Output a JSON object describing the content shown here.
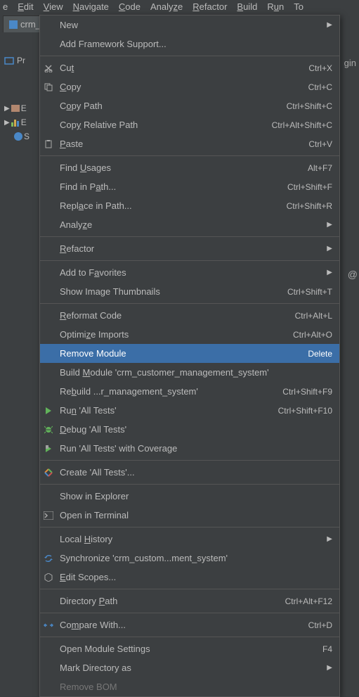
{
  "menubar": {
    "file": "e",
    "edit": "Edit",
    "view": "View",
    "navigate": "Navigate",
    "code": "Code",
    "analyze": "Analyze",
    "refactor": "Refactor",
    "build": "Build",
    "run": "Run",
    "tools": "To"
  },
  "tab": {
    "label": "crm_c"
  },
  "sidebar": {
    "project": "Pr",
    "tree1": "E",
    "tree2": "E",
    "tree3": "S"
  },
  "bg": {
    "gin": "gin",
    "at": "@"
  },
  "menu": {
    "new": "New",
    "addfw": "Add Framework Support...",
    "cut": "Cut",
    "cut_s": "Ctrl+X",
    "copy": "Copy",
    "copy_s": "Ctrl+C",
    "copypath": "Copy Path",
    "copypath_s": "Ctrl+Shift+C",
    "copyrel": "Copy Relative Path",
    "copyrel_s": "Ctrl+Alt+Shift+C",
    "paste": "Paste",
    "paste_s": "Ctrl+V",
    "findu": "Find Usages",
    "findu_s": "Alt+F7",
    "findp": "Find in Path...",
    "findp_s": "Ctrl+Shift+F",
    "replp": "Replace in Path...",
    "replp_s": "Ctrl+Shift+R",
    "analyze": "Analyze",
    "refactor": "Refactor",
    "addfav": "Add to Favorites",
    "showimg": "Show Image Thumbnails",
    "showimg_s": "Ctrl+Shift+T",
    "reformat": "Reformat Code",
    "reformat_s": "Ctrl+Alt+L",
    "optimp": "Optimize Imports",
    "optimp_s": "Ctrl+Alt+O",
    "remmod": "Remove Module",
    "remmod_s": "Delete",
    "buildmod": "Build Module 'crm_customer_management_system'",
    "rebuild": "Rebuild ...r_management_system'",
    "rebuild_s": "Ctrl+Shift+F9",
    "runall": "Run 'All Tests'",
    "runall_s": "Ctrl+Shift+F10",
    "debugall": "Debug 'All Tests'",
    "covall": "Run 'All Tests' with Coverage",
    "createall": "Create 'All Tests'...",
    "showexp": "Show in Explorer",
    "openterm": "Open in Terminal",
    "localhist": "Local History",
    "sync": "Synchronize 'crm_custom...ment_system'",
    "editscopes": "Edit Scopes...",
    "dirpath": "Directory Path",
    "dirpath_s": "Ctrl+Alt+F12",
    "compare": "Compare With...",
    "compare_s": "Ctrl+D",
    "openmod": "Open Module Settings",
    "openmod_s": "F4",
    "markdir": "Mark Directory as",
    "rembom": "Remove BOM"
  }
}
